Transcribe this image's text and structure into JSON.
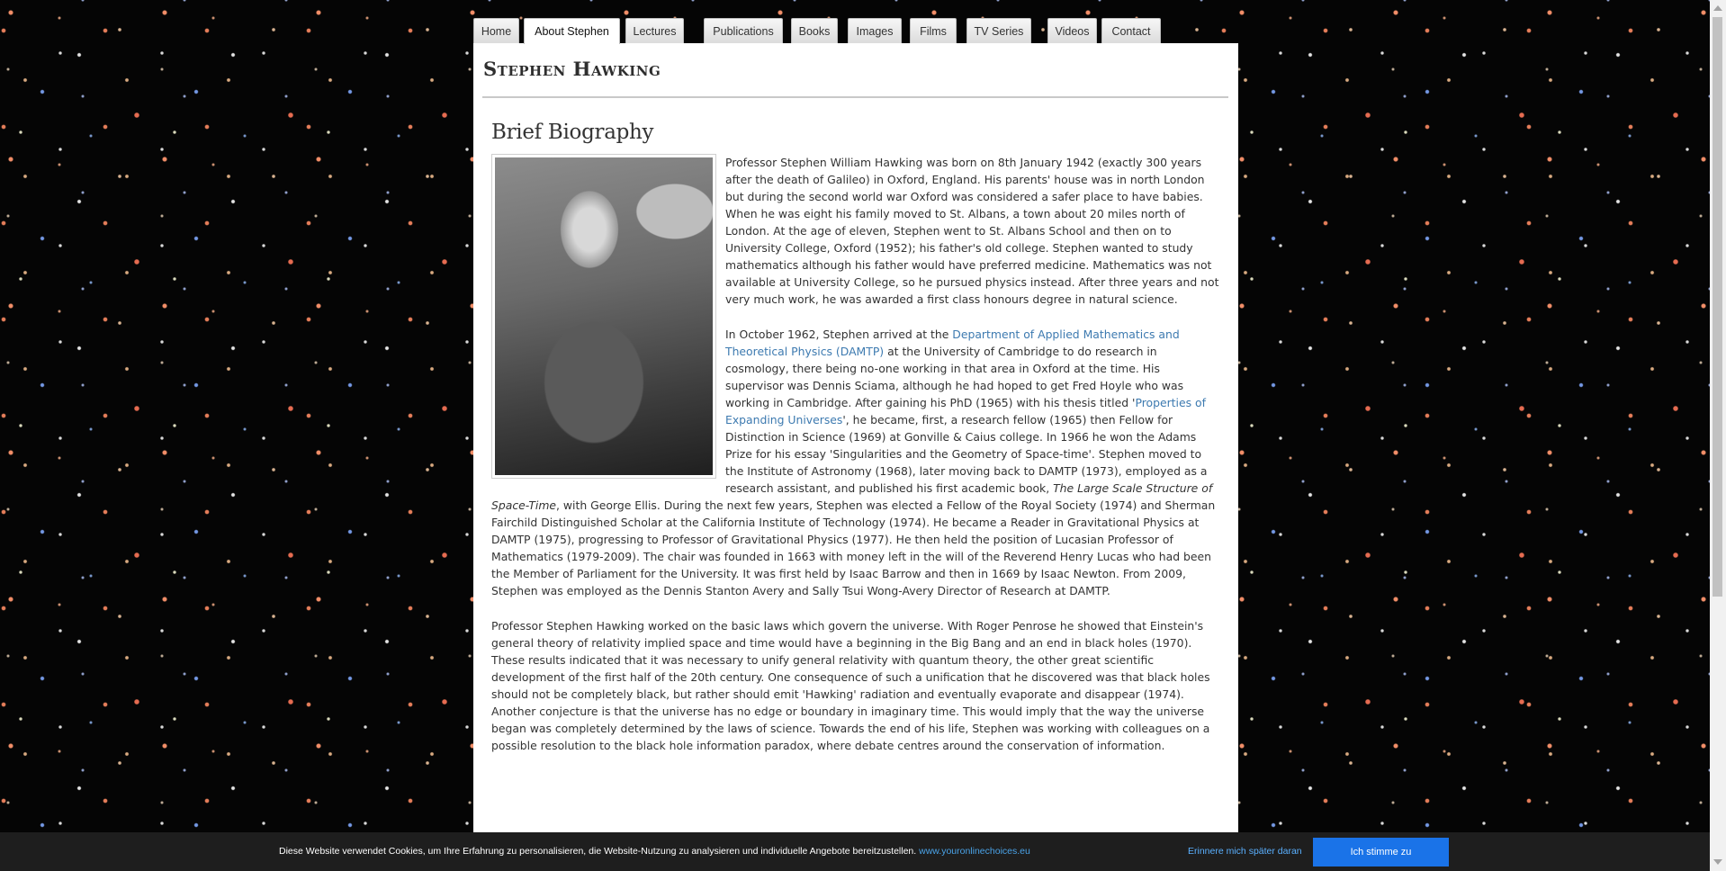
{
  "nav": {
    "tabs": [
      {
        "label": "Home"
      },
      {
        "label": "About Stephen",
        "active": true
      },
      {
        "label": "Lectures"
      },
      {
        "label": "Publications"
      },
      {
        "label": "Books"
      },
      {
        "label": "Images"
      },
      {
        "label": "Films"
      },
      {
        "label": "TV Series"
      },
      {
        "label": "Videos"
      },
      {
        "label": "Contact"
      }
    ]
  },
  "site": {
    "title": "Stephen Hawking"
  },
  "article": {
    "heading": "Brief Biography",
    "p1": "Professor Stephen William Hawking was born on 8th January 1942 (exactly 300 years after the death of Galileo) in Oxford, England. His parents' house was in north London but during the second world war Oxford was considered a safer place to have babies. When he was eight his family moved to St. Albans, a town about 20 miles north of London. At the age of eleven, Stephen went to St. Albans School and then on to University College, Oxford (1952); his father's old college. Stephen wanted to study mathematics although his father would have preferred medicine. Mathematics was not available at University College, so he pursued physics instead. After three years and not very much work, he was awarded a first class honours degree in natural science.",
    "p2": {
      "t1": "In October 1962, Stephen arrived at the ",
      "link1": "Department of Applied Mathematics and Theoretical Physics (DAMTP)",
      "t2": " at the University of Cambridge to do research in cosmology, there being no-one working in that area in Oxford at the time. His supervisor was Dennis Sciama, although he had hoped to get Fred Hoyle who was working in Cambridge. After gaining his PhD (1965) with his thesis titled '",
      "link2": "Properties of Expanding Universes",
      "t3": "', he became, first, a research fellow (1965) then Fellow for Distinction in Science (1969) at Gonville & Caius college. In 1966 he won the Adams Prize for his essay 'Singularities and the Geometry of Space-time'. Stephen moved to the Institute of Astronomy (1968), later moving back to DAMTP (1973), employed as a research assistant, and published his first academic book, ",
      "book": "The Large Scale Structure of Space-Time",
      "t4": ", with George Ellis. During the next few years, Stephen was elected a Fellow of the Royal Society (1974) and Sherman Fairchild Distinguished Scholar at the California Institute of Technology (1974). He became a Reader in Gravitational Physics at DAMTP (1975), progressing to Professor of Gravitational Physics (1977). He then held the position of Lucasian Professor of Mathematics (1979-2009). The chair was founded in 1663 with money left in the will of the Reverend Henry Lucas who had been the Member of Parliament for the University. It was first held by Isaac Barrow and then in 1669 by Isaac Newton.  From 2009, Stephen was employed as the Dennis Stanton Avery and Sally Tsui Wong-Avery Director of Research at DAMTP."
    },
    "p3": "Professor Stephen Hawking worked on the basic laws which govern the universe. With Roger Penrose he showed that Einstein's general theory of relativity implied space and time would have a beginning in the Big Bang and an end in black holes (1970). These results indicated that it was necessary to unify general relativity with quantum theory, the other great scientific development of the first half of the 20th century. One consequence of such a unification that he discovered was that black holes should not be completely black, but rather should emit 'Hawking' radiation and eventually evaporate and disappear (1974). Another conjecture is that the universe has no edge or boundary in imaginary time. This would imply that the way the universe began was completely determined by the laws of science. Towards the end of his life, Stephen was working with colleagues on a possible resolution to the black hole information paradox, where debate centres around the conservation of information."
  },
  "cookie": {
    "text": "Diese Website verwendet Cookies, um Ihre Erfahrung zu personalisieren, die Website-Nutzung zu analysieren und individuelle Angebote bereitzustellen.",
    "link": "www.youronlinechoices.eu",
    "remind": "Erinnere mich später daran",
    "agree": "Ich stimme zu"
  },
  "colors": {
    "link": "#3d7ab0",
    "cookie_button": "#1a73e8",
    "cookie_remind": "#5ab0ff"
  }
}
